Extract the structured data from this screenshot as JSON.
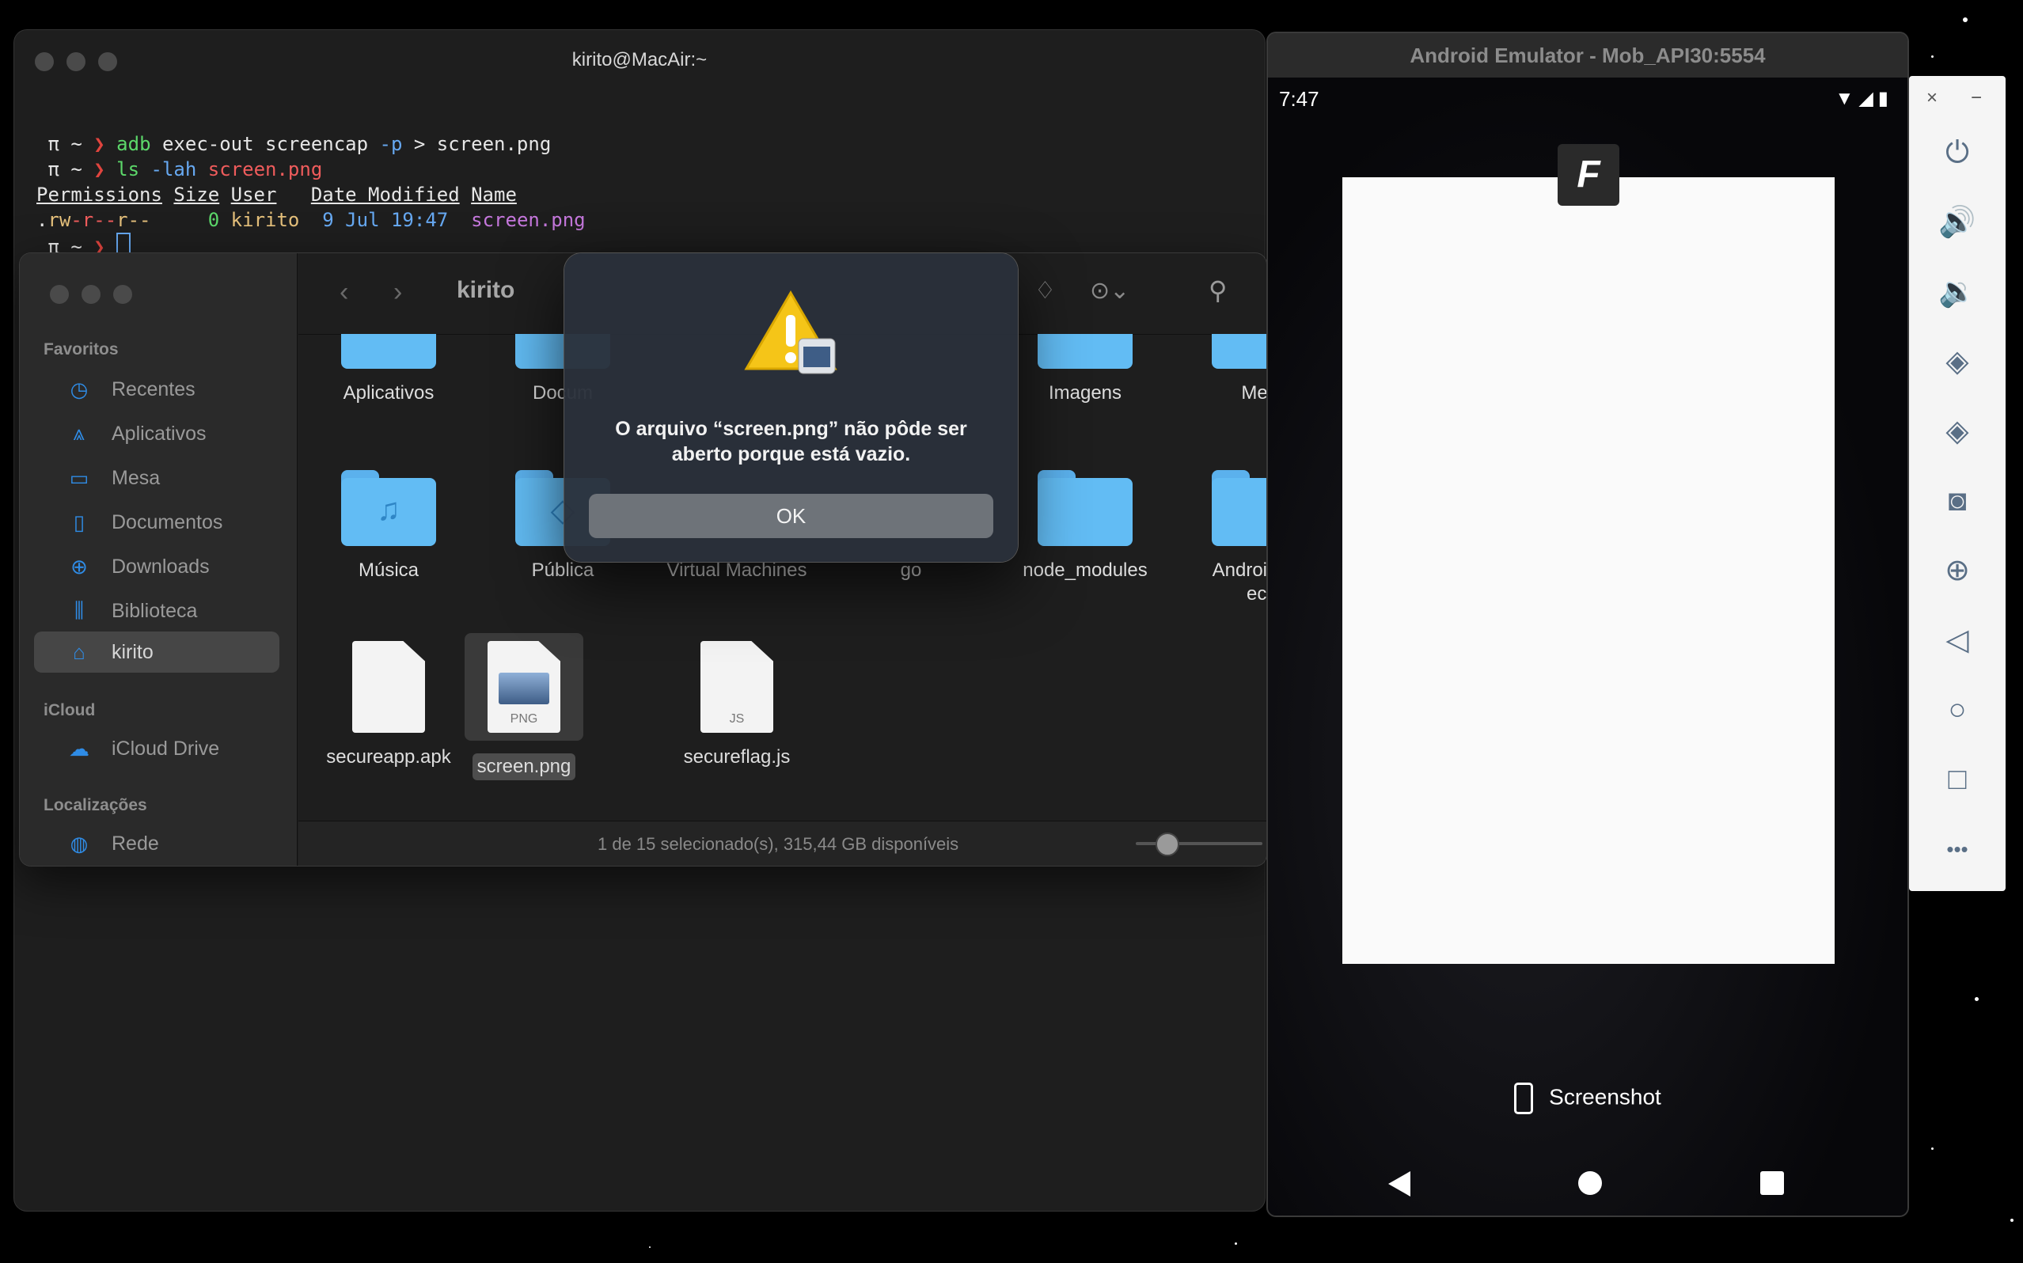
{
  "terminal": {
    "title": "kirito@MacAir:~",
    "prompt_pi": "π",
    "prompt_tilde": "~",
    "prompt_arrow": "❯",
    "line1_cmd": "adb",
    "line1_args": " exec-out screencap ",
    "line1_flag": "-p",
    "line1_rest": " > screen.png",
    "line2_cmd": "ls",
    "line2_flag": " -lah ",
    "line2_file": "screen.png",
    "headers": {
      "permissions": "Permissions",
      "size": "Size",
      "user": "User",
      "date": "Date Modified",
      "name": "Name"
    },
    "row": {
      "perm_dot": ".",
      "perm_rw": "rw",
      "perm_r1": "-r--",
      "perm_r2": "r--",
      "size": "0",
      "user": "kirito",
      "date": "9 Jul 19:47",
      "name": "screen.png"
    }
  },
  "finder": {
    "title": "kirito",
    "sidebar": {
      "favorites_label": "Favoritos",
      "favorites": [
        {
          "label": "Recentes",
          "icon": "clock-icon"
        },
        {
          "label": "Aplicativos",
          "icon": "apps-icon"
        },
        {
          "label": "Mesa",
          "icon": "desktop-icon"
        },
        {
          "label": "Documentos",
          "icon": "document-icon"
        },
        {
          "label": "Downloads",
          "icon": "download-icon"
        },
        {
          "label": "Biblioteca",
          "icon": "library-icon"
        },
        {
          "label": "kirito",
          "icon": "home-icon"
        }
      ],
      "icloud_label": "iCloud",
      "icloud_drive": "iCloud Drive",
      "locations_label": "Localizações",
      "network": "Rede"
    },
    "items_row1": [
      "Aplicativos",
      "Docum",
      "Imagens",
      "Mes"
    ],
    "items_row2": [
      "Música",
      "Pública",
      "Virtual Machines",
      "go",
      "node_modules",
      "AndroidStu",
      "ect"
    ],
    "items_row3": [
      "secureapp.apk",
      "screen.png",
      "secureflag.js"
    ],
    "png_ext": "PNG",
    "js_ext": "JS",
    "status": "1 de 15 selecionado(s), 315,44 GB disponíveis"
  },
  "alert": {
    "message_line1": "O arquivo “screen.png” não pôde ser",
    "message_line2": "aberto porque está vazio.",
    "ok": "OK"
  },
  "emulator": {
    "title": "Android Emulator - Mob_API30:5554",
    "time": "7:47",
    "screenshot_label": "Screenshot",
    "side_close": "×",
    "side_minimize": "−",
    "side_more": "•••"
  },
  "colors": {
    "accent": "#2f8ce6",
    "folder": "#62bcf4",
    "terminal_bg": "#1e1e1e"
  }
}
